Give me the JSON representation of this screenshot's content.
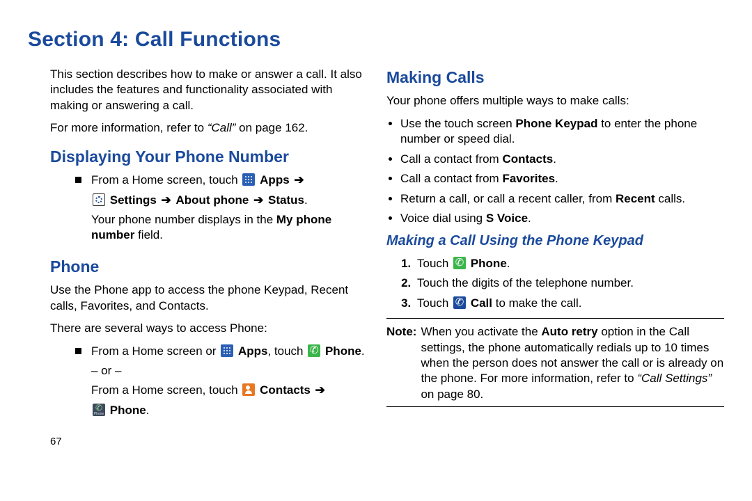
{
  "title": "Section 4: Call Functions",
  "left": {
    "intro": "This section describes how to make or answer a call. It also includes the features and functionality associated with making or answering a call.",
    "ref_pre": "For more information, refer to ",
    "ref_em": "“Call”",
    "ref_post": " on page 162.",
    "h2a": "Displaying Your Phone Number",
    "sq1_line1_pre": "From a Home screen, touch ",
    "sq1_apps": "Apps",
    "sq1_line2_settings": "Settings",
    "sq1_line2_about": "About phone",
    "sq1_line2_status": "Status",
    "sq1_line3_pre": "Your phone number displays in the ",
    "sq1_line3_bold": "My phone number",
    "sq1_line3_post": " field.",
    "h2b": "Phone",
    "p_phone": "Use the Phone app to access the phone Keypad, Recent calls, Favorites, and Contacts.",
    "p_phone2": "There are several ways to access Phone:",
    "sq2_line1_pre": "From a Home screen or ",
    "sq2_apps": "Apps",
    "sq2_line1_mid": ", touch ",
    "sq2_phone": "Phone",
    "sq2_or": "– or –",
    "sq2_line2_pre": "From a Home screen, touch ",
    "sq2_contacts": "Contacts",
    "sq2_phone2": "Phone"
  },
  "right": {
    "h2": "Making Calls",
    "intro": "Your phone offers multiple ways to make calls:",
    "b1_pre": "Use the touch screen ",
    "b1_bold": "Phone Keypad",
    "b1_post": " to enter the phone number or speed dial.",
    "b2_pre": "Call a contact from ",
    "b2_bold": "Contacts",
    "b3_pre": "Call a contact from ",
    "b3_bold": "Favorites",
    "b4_pre": "Return a call, or call a recent caller, from ",
    "b4_bold": "Recent",
    "b4_post": " calls.",
    "b5_pre": "Voice dial using ",
    "b5_bold": "S Voice",
    "h3": "Making a Call Using the Phone Keypad",
    "s1_pre": "Touch ",
    "s1_bold": "Phone",
    "s2": "Touch the digits of the telephone number.",
    "s3_pre": "Touch ",
    "s3_bold": "Call",
    "s3_post": " to make the call.",
    "note_label": "Note:",
    "note_pre": " When you activate the ",
    "note_bold": "Auto retry",
    "note_mid": " option in the Call settings, the phone automatically redials up to 10 times when the person does not answer the call or is already on the phone. For more information, refer to ",
    "note_em": "“Call Settings”",
    "note_post": " on page 80."
  },
  "page_num": "67"
}
